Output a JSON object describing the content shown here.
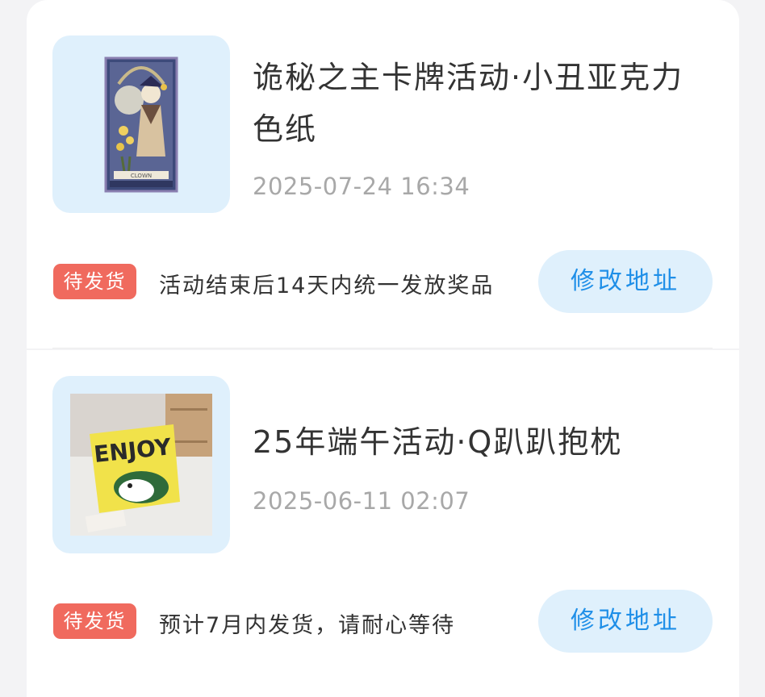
{
  "orders": [
    {
      "title": "诡秘之主卡牌活动·小丑亚克力色纸",
      "date": "2025-07-24 16:34",
      "badge": "待发货",
      "note": "活动结束后14天内统一发放奖品",
      "button": "修改地址",
      "image_icon": "clown-tarot-card-image"
    },
    {
      "title": "25年端午活动·Q趴趴抱枕",
      "date": "2025-06-11 02:07",
      "badge": "待发货",
      "note": "预计7月内发货，请耐心等待",
      "button": "修改地址",
      "image_icon": "enjoy-pillow-image"
    }
  ],
  "images": {
    "card_caption": "CLOWN",
    "pillow_text": "ENJOY"
  },
  "colors": {
    "badge_bg": "#f06a5e",
    "button_bg": "#dff0fc",
    "button_text": "#1f8fe8",
    "thumb_bg": "#dff0fc"
  }
}
